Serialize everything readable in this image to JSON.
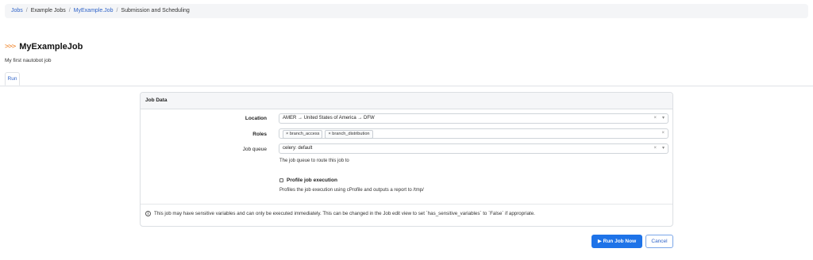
{
  "breadcrumb": {
    "jobs": "Jobs",
    "example_jobs": "Example Jobs",
    "job": "MyExample.Job",
    "current": "Submission and Scheduling"
  },
  "header": {
    "chevrons": ">>>",
    "title": "MyExampleJob",
    "subtitle": "My first nautobot job"
  },
  "tabs": [
    {
      "label": "Run"
    }
  ],
  "panel": {
    "title": "Job Data",
    "location": {
      "label": "Location",
      "value": "AMER → United States of America → DFW"
    },
    "roles": {
      "label": "Roles",
      "tags": [
        "× branch_access",
        "× branch_distribution"
      ]
    },
    "job_queue": {
      "label": "Job queue",
      "value": "celery: default",
      "help": "The job queue to route this job to"
    },
    "profile": {
      "label": "Profile job execution",
      "help": "Profiles the job execution using cProfile and outputs a report to /tmp/"
    },
    "controls": {
      "clear": "×",
      "dropdown": "▾"
    },
    "warning": "This job may have sensitive variables and can only be executed immediately. This can be changed in the Job edit view to set `has_sensitive_variables` to `False` if appropriate."
  },
  "actions": {
    "run": "▶ Run Job Now",
    "cancel": "Cancel"
  },
  "colors": {
    "primary": "#1e73e8",
    "link": "#2f63c8",
    "accent": "#f08a34"
  }
}
